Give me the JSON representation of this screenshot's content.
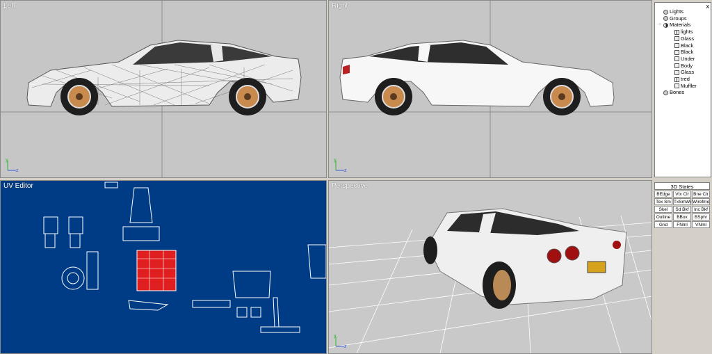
{
  "viewports": {
    "left": {
      "label": "Left"
    },
    "right": {
      "label": "Right"
    },
    "uv": {
      "label": "UV Editor"
    },
    "perspective": {
      "label": "Perspective"
    }
  },
  "axis": {
    "y": "y",
    "z": "z"
  },
  "scene_tree": {
    "close_glyph": "x",
    "items": [
      {
        "label": "Lights",
        "icon": "light-icon",
        "depth": 1,
        "expander": ""
      },
      {
        "label": "Groups",
        "icon": "group-icon",
        "depth": 1,
        "expander": ""
      },
      {
        "label": "Materials",
        "icon": "materials-icon",
        "depth": 1,
        "expander": "−"
      },
      {
        "label": "lights",
        "icon": "texture-icon",
        "depth": 2,
        "expander": ""
      },
      {
        "label": "Glass",
        "icon": "material-icon",
        "depth": 2,
        "expander": ""
      },
      {
        "label": "Black",
        "icon": "material-icon",
        "depth": 2,
        "expander": ""
      },
      {
        "label": "Black",
        "icon": "material-icon",
        "depth": 2,
        "expander": ""
      },
      {
        "label": "Under",
        "icon": "material-icon",
        "depth": 2,
        "expander": ""
      },
      {
        "label": "Body",
        "icon": "material-icon",
        "depth": 2,
        "expander": ""
      },
      {
        "label": "Glass",
        "icon": "material-icon",
        "depth": 2,
        "expander": ""
      },
      {
        "label": "tred",
        "icon": "texture-icon",
        "depth": 2,
        "expander": ""
      },
      {
        "label": "Muffler",
        "icon": "material-icon",
        "depth": 2,
        "expander": ""
      },
      {
        "label": "Bones",
        "icon": "bones-icon",
        "depth": 1,
        "expander": ""
      }
    ]
  },
  "states_panel": {
    "title": "3D States",
    "buttons": [
      "BEdge",
      "Vtx Clr",
      "Bne Clr",
      "Tex Sm",
      "TxSmWr",
      "Wirefme",
      "Skel",
      "Sd Bkf",
      "Inc Bkf",
      "Outline",
      "BBox",
      "BSphr",
      "Grid",
      "FNml",
      "VNml"
    ]
  },
  "colors": {
    "viewport_bg": "#c6c6c6",
    "uv_bg": "#003b85",
    "panel_bg": "#d4d0c8",
    "body_white": "#f2f2f2",
    "axis_green": "#2bb52b",
    "axis_blue": "#3a5bd9"
  }
}
